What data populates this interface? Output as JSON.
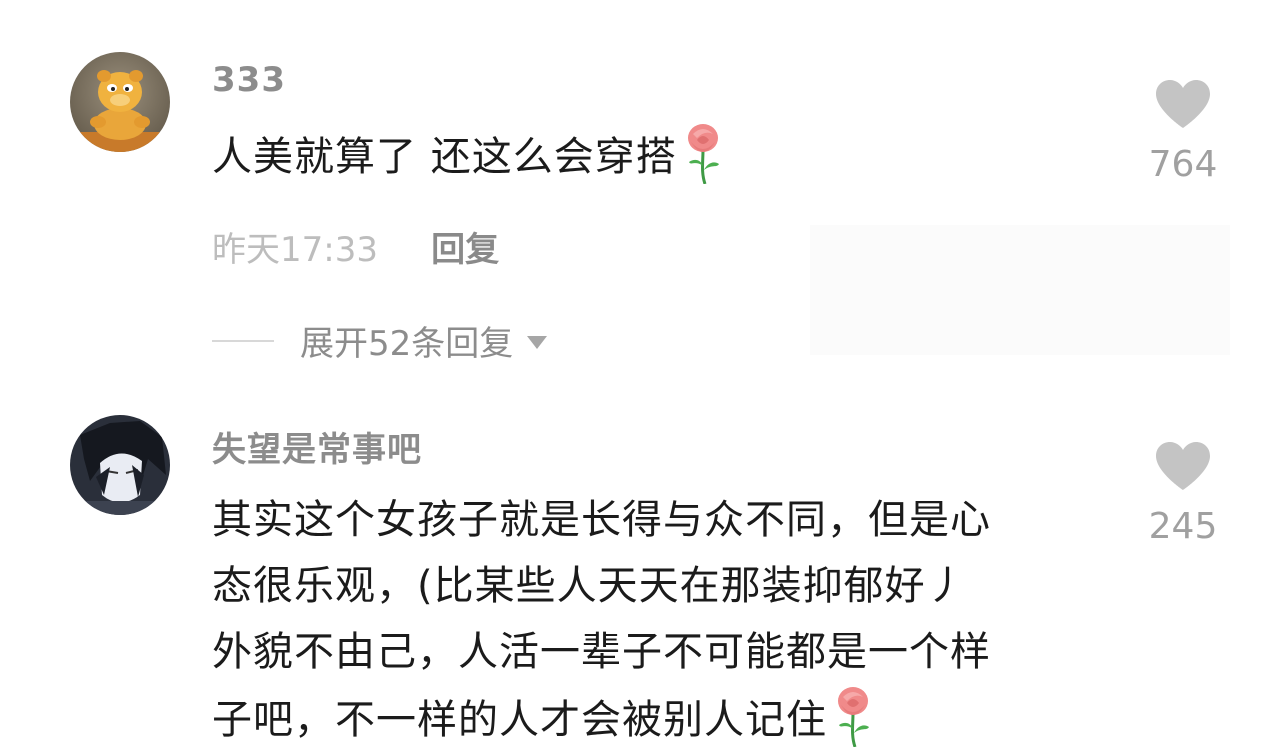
{
  "comments": [
    {
      "username": "333",
      "lines": [
        "人美就算了 还这么会穿搭"
      ],
      "likes": "764",
      "time": "昨天17:33",
      "reply_label": "回复",
      "expand_label": "展开52条回复"
    },
    {
      "username": "失望是常事吧",
      "lines": [
        "其实这个女孩子就是长得与众不同，但是心",
        "态很乐观，(比某些人天天在那装抑郁好丿",
        "外貌不由己，人活一辈子不可能都是一个样",
        "子吧，不一样的人才会被别人记住"
      ],
      "likes": "245"
    }
  ],
  "icons": {
    "like": "heart-icon",
    "emoji": "rose-emoji-icon",
    "expand": "caret-down-icon"
  },
  "colors": {
    "heart": "#c4c4c4",
    "username": "#8c8c8c",
    "body": "#1b1b1b",
    "meta": "#bdbdbd",
    "rose_petal": "#f08a8a",
    "rose_stem": "#3f9a45"
  }
}
